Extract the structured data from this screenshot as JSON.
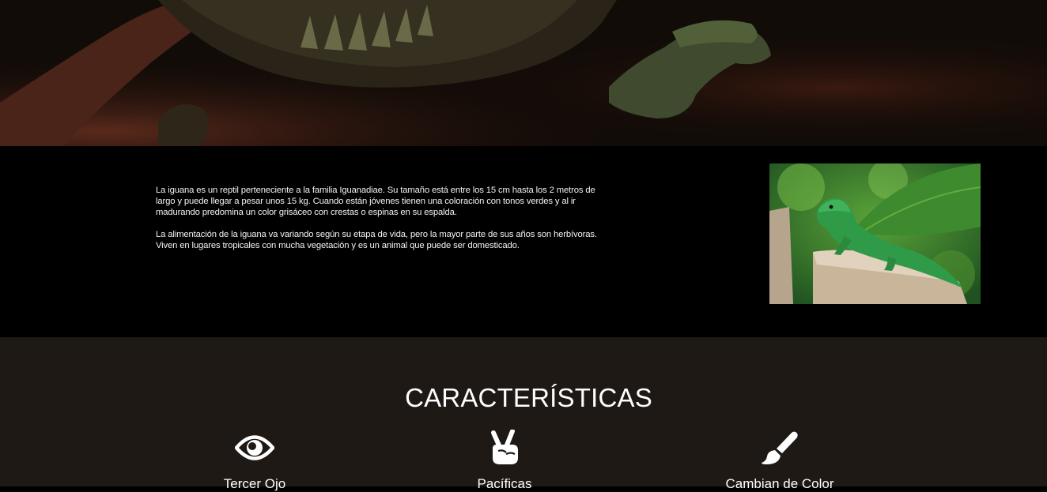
{
  "hero": {
    "image": "iguana-closeup-dark"
  },
  "intro": {
    "paragraphs": [
      "La iguana es un reptil perteneciente a la familia Iguanadiae. Su tamaño está entre los 15 cm hasta los 2 metros de largo y puede llegar a pesar unos 15 kg. Cuando están jóvenes tienen una coloración con tonos verdes y al ir madurando predomina un color grisáceo con crestas o espinas en su espalda.",
      "La alimentación de la iguana va variando según su etapa de vida, pero la mayor parte de sus años son herbívoras. Viven en lugares tropicales con mucha vegetación y es un animal que puede ser domesticado."
    ],
    "photo": "green-iguana-on-stump"
  },
  "features": {
    "title": "CARACTERÍSTICAS",
    "items": [
      {
        "icon": "eye-icon",
        "label": "Tercer Ojo"
      },
      {
        "icon": "peace-hand-icon",
        "label": "Pacíficas"
      },
      {
        "icon": "paintbrush-icon",
        "label": "Cambian de Color"
      }
    ]
  },
  "colors": {
    "intro_bg": "#000000",
    "features_bg": "#1e1915",
    "text": "#ffffff"
  }
}
